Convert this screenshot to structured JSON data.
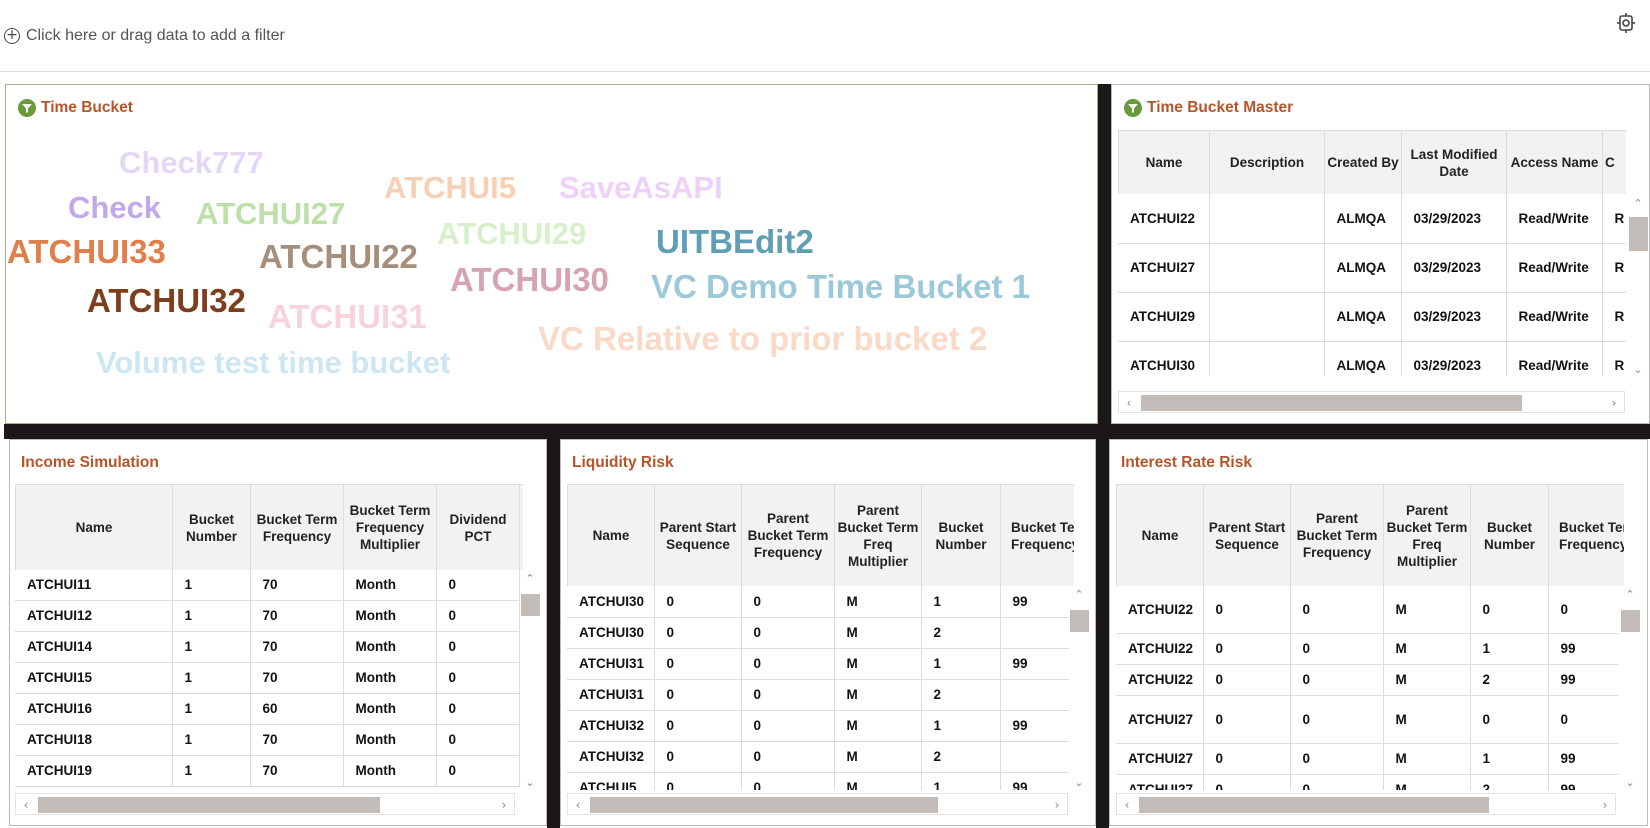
{
  "filter_bar": {
    "add_filter_label": "Click here or drag data to add a filter"
  },
  "time_bucket": {
    "title": "Time Bucket",
    "words": [
      {
        "text": "Check777",
        "color": "#e3d6f7"
      },
      {
        "text": "Check",
        "color": "#c2a8ea"
      },
      {
        "text": "ATCHUI5",
        "color": "#f9cfb3"
      },
      {
        "text": "SaveAsAPI",
        "color": "#efd0f9"
      },
      {
        "text": "ATCHUI27",
        "color": "#bde0a8"
      },
      {
        "text": "ATCHUI29",
        "color": "#d8efcb"
      },
      {
        "text": "UITBEdit2",
        "color": "#5f9fb4"
      },
      {
        "text": "ATCHUI33",
        "color": "#e07f4a"
      },
      {
        "text": "ATCHUI22",
        "color": "#a68e7a"
      },
      {
        "text": "ATCHUI30",
        "color": "#d6a3b0"
      },
      {
        "text": "VC Demo Time Bucket 1",
        "color": "#9cc9d9"
      },
      {
        "text": "ATCHUI32",
        "color": "#7d3e1c"
      },
      {
        "text": "ATCHUI31",
        "color": "#f7d3dc"
      },
      {
        "text": "VC Relative to prior bucket 2",
        "color": "#fad9c6"
      },
      {
        "text": "Volume test time bucket",
        "color": "#cde6f4"
      }
    ]
  },
  "time_bucket_master": {
    "title": "Time Bucket Master",
    "columns": [
      "Name",
      "Description",
      "Created By",
      "Last Modified Date",
      "Access Name",
      "C"
    ],
    "rows": [
      [
        "ATCHUI22",
        "",
        "ALMQA",
        "03/29/2023",
        "Read/Write",
        "R P"
      ],
      [
        "ATCHUI27",
        "",
        "ALMQA",
        "03/29/2023",
        "Read/Write",
        "R P"
      ],
      [
        "ATCHUI29",
        "",
        "ALMQA",
        "03/29/2023",
        "Read/Write",
        "R P"
      ],
      [
        "ATCHUI30",
        "",
        "ALMQA",
        "03/29/2023",
        "Read/Write",
        "R P"
      ]
    ]
  },
  "income_simulation": {
    "title": "Income Simulation",
    "columns": [
      "Name",
      "Bucket Number",
      "Bucket Term Frequency",
      "Bucket Term Frequency Multiplier",
      "Dividend PCT"
    ],
    "rows": [
      [
        "ATCHUI11",
        "1",
        "70",
        "Month",
        "0"
      ],
      [
        "ATCHUI12",
        "1",
        "70",
        "Month",
        "0"
      ],
      [
        "ATCHUI14",
        "1",
        "70",
        "Month",
        "0"
      ],
      [
        "ATCHUI15",
        "1",
        "70",
        "Month",
        "0"
      ],
      [
        "ATCHUI16",
        "1",
        "60",
        "Month",
        "0"
      ],
      [
        "ATCHUI18",
        "1",
        "70",
        "Month",
        "0"
      ],
      [
        "ATCHUI19",
        "1",
        "70",
        "Month",
        "0"
      ]
    ]
  },
  "liquidity_risk": {
    "title": "Liquidity Risk",
    "columns": [
      "Name",
      "Parent Start Sequence",
      "Parent Bucket Term Frequency",
      "Parent Bucket Term Freq Multiplier",
      "Bucket Number",
      "Bucket Term Frequency"
    ],
    "rows": [
      [
        "ATCHUI30",
        "0",
        "0",
        "M",
        "1",
        "99"
      ],
      [
        "ATCHUI30",
        "0",
        "0",
        "M",
        "2",
        ""
      ],
      [
        "ATCHUI31",
        "0",
        "0",
        "M",
        "1",
        "99"
      ],
      [
        "ATCHUI31",
        "0",
        "0",
        "M",
        "2",
        ""
      ],
      [
        "ATCHUI32",
        "0",
        "0",
        "M",
        "1",
        "99"
      ],
      [
        "ATCHUI32",
        "0",
        "0",
        "M",
        "2",
        ""
      ],
      [
        "ATCHUI5",
        "0",
        "0",
        "M",
        "1",
        "99"
      ]
    ]
  },
  "interest_rate_risk": {
    "title": "Interest Rate Risk",
    "columns": [
      "Name",
      "Parent Start Sequence",
      "Parent Bucket Term Frequency",
      "Parent Bucket Term Freq Multiplier",
      "Bucket Number",
      "Bucket Term Frequency"
    ],
    "rows": [
      [
        "ATCHUI22",
        "0",
        "0",
        "M",
        "0",
        "0"
      ],
      [
        "ATCHUI22",
        "0",
        "0",
        "M",
        "1",
        "99"
      ],
      [
        "ATCHUI22",
        "0",
        "0",
        "M",
        "2",
        "99"
      ],
      [
        "ATCHUI27",
        "0",
        "0",
        "M",
        "0",
        "0"
      ],
      [
        "ATCHUI27",
        "0",
        "0",
        "M",
        "1",
        "99"
      ],
      [
        "ATCHUI27",
        "0",
        "0",
        "M",
        "2",
        "99"
      ]
    ]
  }
}
